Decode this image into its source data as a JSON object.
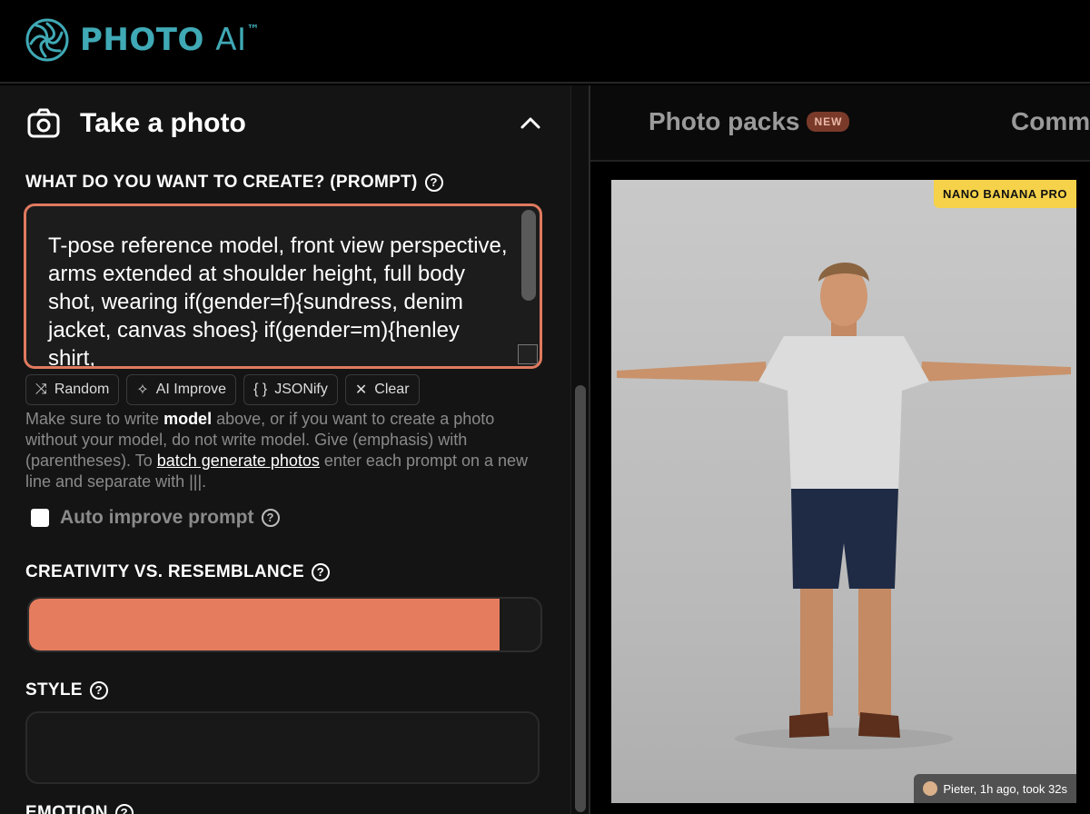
{
  "header": {
    "brand": "PHOTO",
    "brand_ai": "AI",
    "brand_tm": "™"
  },
  "left_panel": {
    "title": "Take a photo",
    "prompt_label": "WHAT DO YOU WANT TO CREATE? (PROMPT)",
    "prompt_value": "T-pose reference model, front view perspective, arms extended at shoulder height, full body shot, wearing if(gender=f){sundress, denim jacket, canvas shoes} if(gender=m){henley shirt,",
    "tools": [
      {
        "icon": "shuffle-icon",
        "label": "Random"
      },
      {
        "icon": "sparkle-icon",
        "label": "AI Improve"
      },
      {
        "icon": "braces-icon",
        "label": "JSONify"
      },
      {
        "icon": "close-icon",
        "label": "Clear"
      }
    ],
    "help": {
      "p1": "Make sure to write ",
      "bold": "model",
      "p2": " above, or if you want to create a photo without your model, do not write model. Give (emphasis) with (parentheses). To ",
      "link": "batch generate photos",
      "p3": " enter each prompt on a new line and separate with |||."
    },
    "auto_improve_label": "Auto improve prompt",
    "auto_improve_checked": false,
    "creativity_label": "CREATIVITY VS. RESEMBLANCE",
    "creativity_value": 0.92,
    "style_label": "STYLE",
    "style_value": "",
    "emotion_label": "EMOTION"
  },
  "right_panel": {
    "tabs": [
      {
        "label": "Photo packs",
        "badge": "NEW"
      },
      {
        "label": "Comm"
      }
    ],
    "image_badge": "NANO BANANA PRO",
    "image_caption": "Pieter, 1h ago, took 32s"
  },
  "colors": {
    "accent": "#e67c5e",
    "brand": "#3fa9b5",
    "badge_yellow": "#f5d24a"
  }
}
